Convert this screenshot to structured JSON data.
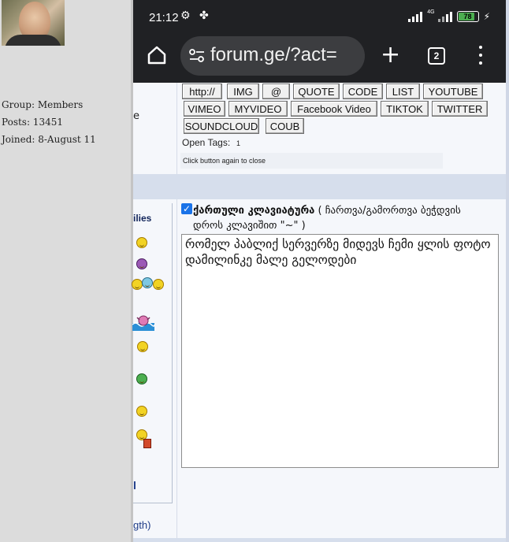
{
  "profile": {
    "group": "Group: Members",
    "posts": "Posts: 13451",
    "joined": "Joined: 8-August 11"
  },
  "status_bar": {
    "time": "21:12",
    "network": "4G",
    "battery_percent": "78"
  },
  "browser": {
    "url": "forum.ge/?act=",
    "tabs_count": "2",
    "icons": [
      "home-icon",
      "site-settings-icon",
      "new-tab-icon",
      "tab-switcher-icon",
      "more-menu-icon"
    ]
  },
  "fragments": {
    "left_e": "e",
    "smilies": "ilies",
    "smilies_l": "l",
    "length": "gth)"
  },
  "bbcode": {
    "buttons": [
      "http://",
      "IMG",
      "@",
      "QUOTE",
      "CODE",
      "LIST",
      "YOUTUBE",
      "VIMEO",
      "MYVIDEO",
      "Facebook Video",
      "TIKTOK",
      "TWITTER",
      "SOUNDCLOUD",
      "COUB"
    ],
    "open_tags_label": "Open Tags:",
    "open_tags_value": "1",
    "close_hint": "Click button again to close"
  },
  "editor": {
    "checkbox_checked": true,
    "georgian_label": "ქართული კლავიატურა",
    "georgian_hint": "( ჩართვა/გამორთვა ბეჭდვის დროს კლავიშით \"~\" )",
    "text": "რომელ პაბლიქ სერვერზე მიდევს ჩემი ყლის ფოტო  დამილინკე მალე გელოდები"
  },
  "colors": {
    "accent_blue": "#1a73e8",
    "battery_green": "#4caf50",
    "toolbar_dark": "#202124",
    "link_blue": "#1f3c88"
  }
}
